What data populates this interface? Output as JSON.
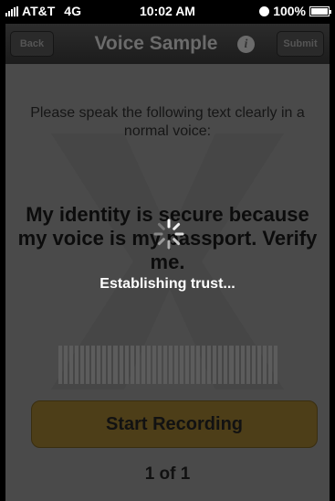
{
  "status_bar": {
    "carrier": "AT&T",
    "network": "4G",
    "time": "10:02 AM",
    "battery": "100%",
    "battery_level": 1.0
  },
  "nav": {
    "back_label": "Back",
    "title": "Voice Sample",
    "info_icon": "info-icon",
    "submit_label": "Submit"
  },
  "content": {
    "instruction": "Please speak the following text clearly in a normal voice:",
    "phrase": "My identity is secure because my voice is my passport. Verify me.",
    "record_button": "Start Recording",
    "page_counter": "1 of 1"
  },
  "overlay": {
    "message": "Establishing trust...",
    "spinner_icon": "activity-spinner-icon"
  },
  "colors": {
    "record_button": "#4d3e18",
    "overlay_text": "#ffffff"
  }
}
